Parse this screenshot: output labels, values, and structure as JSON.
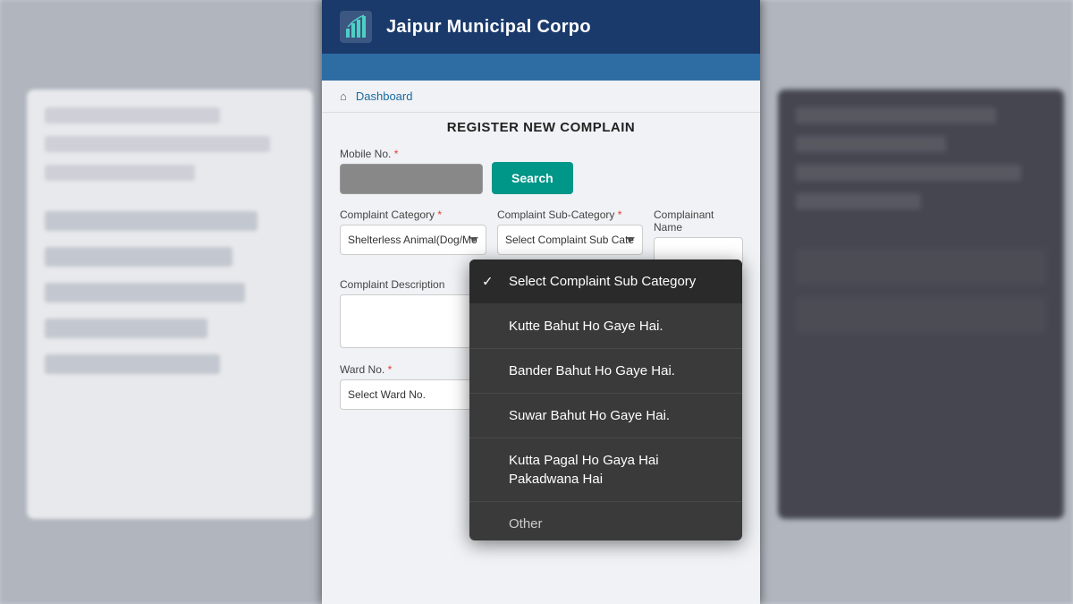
{
  "header": {
    "title": "Jaipur Municipal Corpo",
    "logo_icon": "📊"
  },
  "breadcrumb": {
    "home_icon": "⌂",
    "home_label": "Dashboard"
  },
  "page": {
    "title": "REGISTER NEW COMPLAIN"
  },
  "form": {
    "mobile_label": "Mobile No.",
    "search_btn": "Search",
    "complaint_category_label": "Complaint Category",
    "complaint_subcategory_label": "Complaint Sub-Category",
    "complainant_name_label": "Complainant Name",
    "complaint_description_label": "Complaint Description",
    "ward_no_label": "Ward No.",
    "category_value": "Shelterless Animal(Dog/Mo",
    "subcategory_placeholder": "Select Complaint Sub Cate",
    "ward_placeholder": "Select Ward No."
  },
  "dropdown": {
    "items": [
      {
        "id": "default",
        "label": "Select Complaint Sub Category",
        "selected": true
      },
      {
        "id": "kutte",
        "label": "Kutte Bahut Ho Gaye Hai.",
        "selected": false
      },
      {
        "id": "bander",
        "label": "Bander Bahut Ho Gaye Hai.",
        "selected": false
      },
      {
        "id": "suwar",
        "label": "Suwar Bahut Ho Gaye Hai.",
        "selected": false
      },
      {
        "id": "kutta-pagal",
        "label": "Kutta Pagal Ho Gaya Hai Pakadwana Hai",
        "selected": false
      },
      {
        "id": "other",
        "label": "Other",
        "selected": false
      }
    ]
  }
}
